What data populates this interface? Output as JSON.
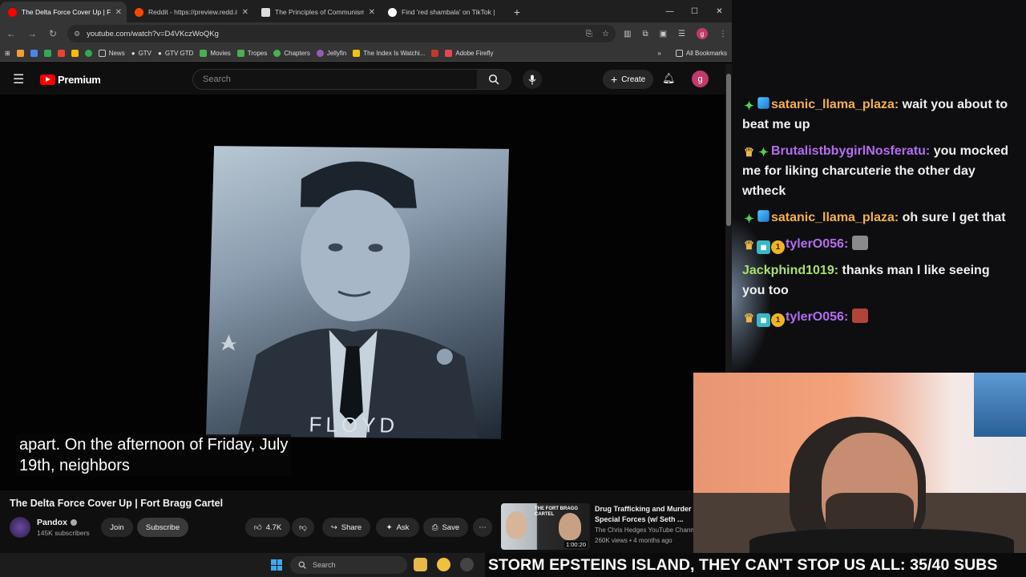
{
  "browser": {
    "tabs": [
      {
        "title": "The Delta Force Cover Up | Fort",
        "active": true,
        "favicon_color": "#ff0000"
      },
      {
        "title": "Reddit - https://preview.redd.it/",
        "active": false,
        "favicon_color": "#ff4500"
      },
      {
        "title": "The Principles of Communism",
        "active": false,
        "favicon_color": "#dddddd"
      },
      {
        "title": "Find 'red shambala' on TikTok |",
        "active": false,
        "favicon_color": "#ffffff"
      }
    ],
    "url": "youtube.com/watch?v=D4VKczWoQKg",
    "bookmarks": [
      "News",
      "GTV",
      "GTV GTD",
      "Movies",
      "Tropes",
      "Chapters",
      "Jellyfin",
      "The Index Is Watchi...",
      "Adobe Firefly"
    ],
    "all_bookmarks": "All Bookmarks"
  },
  "youtube": {
    "logo_text": "Premium",
    "search_placeholder": "Search",
    "create_label": "Create",
    "avatar_letter": "g",
    "caption_lines": [
      "apart. On the afternoon of Friday, July",
      "19th, neighbors"
    ],
    "photo_name": "FLOYD",
    "video_title": "The Delta Force Cover Up | Fort Bragg Cartel",
    "channel_name": "Pandox",
    "subscribers": "145K subscribers",
    "join_label": "Join",
    "subscribe_label": "Subscribe",
    "likes": "4.7K",
    "share_label": "Share",
    "ask_label": "Ask",
    "save_label": "Save",
    "recommended": {
      "title": "Drug Trafficking and Murder in the Special Forces (w/ Seth ...",
      "channel": "The Chris Hedges YouTube Channel",
      "meta": "260K views • 4 months ago",
      "duration": "1:00:20",
      "thumb_text": "THE FORT BRAGG CARTEL"
    }
  },
  "chat": {
    "messages": [
      {
        "user": "satanic_llama_plaza",
        "color": "#f2b14a",
        "badges": [
          "star",
          "cube"
        ],
        "text": "wait you about to beat me up"
      },
      {
        "user": "BrutalistbbygirlNosferatu",
        "color": "#b56cf0",
        "badges": [
          "crown",
          "star"
        ],
        "text": "you mocked me for liking charcuterie the other day wtheck"
      },
      {
        "user": "satanic_llama_plaza",
        "color": "#f2b14a",
        "badges": [
          "star",
          "cube"
        ],
        "text": "oh sure I get that"
      },
      {
        "user": "tylerO056",
        "color": "#b56cf0",
        "badges": [
          "crown",
          "tile",
          "one"
        ],
        "text": "",
        "emote": "#8a8a8a"
      },
      {
        "user": "Jackphind1019",
        "color": "#a8e06a",
        "badges": [],
        "text": "thanks man I like seeing you too"
      },
      {
        "user": "tylerO056",
        "color": "#b56cf0",
        "badges": [
          "crown",
          "tile",
          "one"
        ],
        "text": "",
        "emote": "#b0443a"
      }
    ]
  },
  "taskbar": {
    "search_placeholder": "Search"
  },
  "ticker": {
    "text": "STORM EPSTEINS ISLAND, THEY CAN'T STOP US ALL: 35/40 SUBS"
  }
}
